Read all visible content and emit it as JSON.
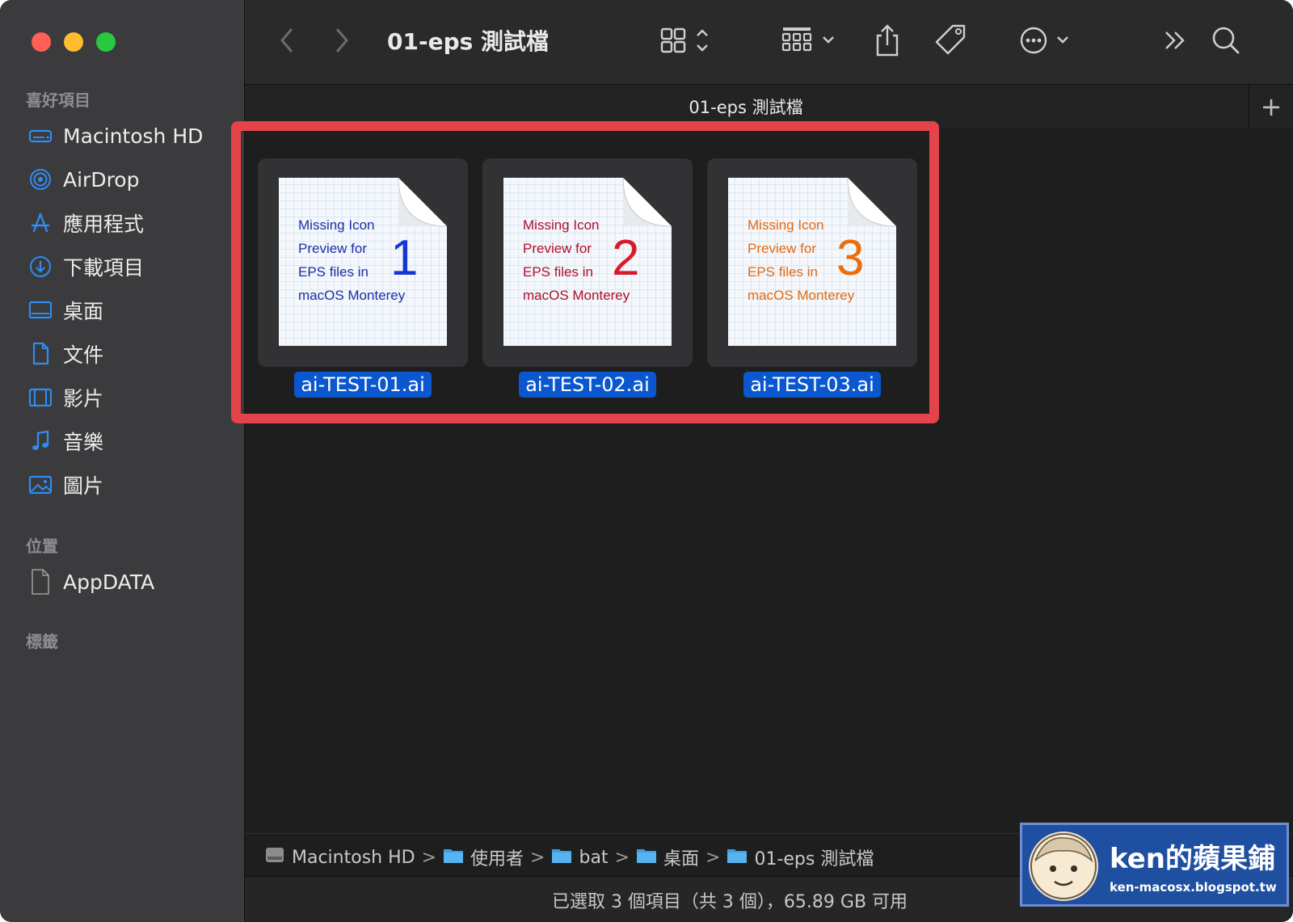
{
  "window": {
    "title": "01-eps 測試檔"
  },
  "sidebar": {
    "favorites_header": "喜好項目",
    "favorites": [
      {
        "label": "Macintosh HD",
        "icon": "hard-drive-icon"
      },
      {
        "label": "AirDrop",
        "icon": "airdrop-icon"
      },
      {
        "label": "應用程式",
        "icon": "applications-icon"
      },
      {
        "label": "下載項目",
        "icon": "downloads-icon"
      },
      {
        "label": "桌面",
        "icon": "desktop-icon"
      },
      {
        "label": "文件",
        "icon": "documents-icon"
      },
      {
        "label": "影片",
        "icon": "movies-icon"
      },
      {
        "label": "音樂",
        "icon": "music-icon"
      },
      {
        "label": "圖片",
        "icon": "pictures-icon"
      }
    ],
    "locations_header": "位置",
    "locations": [
      {
        "label": "AppDATA",
        "icon": "file-icon"
      }
    ],
    "tags_header": "標籤"
  },
  "tab": {
    "title": "01-eps 測試檔"
  },
  "files": [
    {
      "name": "ai-TEST-01.ai",
      "preview_lines": [
        "Missing Icon",
        "Preview for",
        "EPS files in",
        "macOS Monterey"
      ],
      "number": "1",
      "color": "#1b2fa8",
      "number_color": "#1537d6"
    },
    {
      "name": "ai-TEST-02.ai",
      "preview_lines": [
        "Missing Icon",
        "Preview for",
        "EPS files in",
        "macOS Monterey"
      ],
      "number": "2",
      "color": "#b0102a",
      "number_color": "#d81a2a"
    },
    {
      "name": "ai-TEST-03.ai",
      "preview_lines": [
        "Missing Icon",
        "Preview for",
        "EPS files in",
        "macOS Monterey"
      ],
      "number": "3",
      "color": "#e46a10",
      "number_color": "#ec6d0c"
    }
  ],
  "pathbar": {
    "crumbs": [
      "Macintosh HD",
      "使用者",
      "bat",
      "桌面",
      "01-eps 測試檔"
    ],
    "separator": ">"
  },
  "status": {
    "text": "已選取 3 個項目（共 3 個），65.89 GB 可用"
  },
  "watermark": {
    "title": "ken的蘋果鋪",
    "url": "ken-macosx.blogspot.tw"
  },
  "colors": {
    "accent": "#0b57d0",
    "highlight_border": "#e5434a",
    "sidebar_icon": "#2f8cf0"
  }
}
